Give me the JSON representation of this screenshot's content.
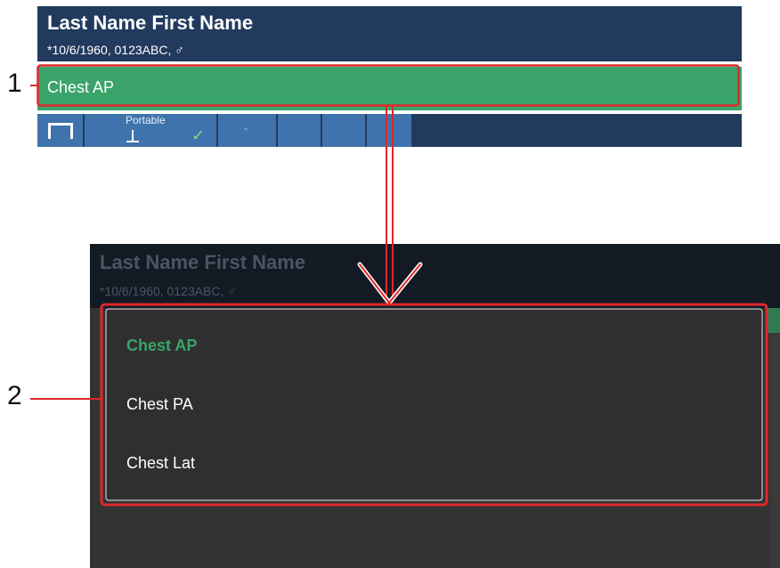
{
  "patient": {
    "name": "Last Name First Name",
    "details": "*10/6/1960, 0123ABC, ♂"
  },
  "procedure": {
    "current": "Chest AP"
  },
  "toolbar": {
    "table_icon": "table-icon",
    "portable_label": "Portable",
    "portable_icon": "portable-detector-icon",
    "checkmark": "✓",
    "dash_label": "-"
  },
  "callouts": {
    "one": "1",
    "two": "2"
  },
  "dropdown": {
    "items": [
      {
        "label": "Chest AP",
        "selected": true
      },
      {
        "label": "Chest PA",
        "selected": false
      },
      {
        "label": "Chest Lat",
        "selected": false
      }
    ]
  },
  "colors": {
    "header_bg": "#223a5e",
    "procedure_green": "#3aa46a",
    "toolbar_button": "#3f73ad",
    "dropdown_bg": "#2f2f2f",
    "callout_red": "#e0262b"
  }
}
